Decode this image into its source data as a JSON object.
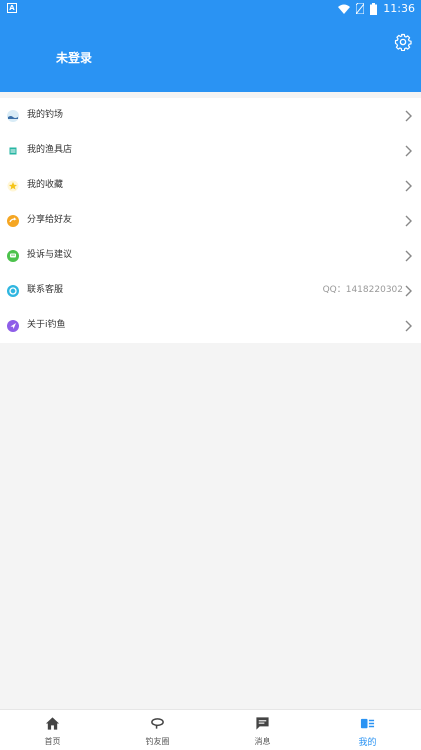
{
  "status_bar": {
    "left_badge": "A",
    "time": "11:36"
  },
  "header": {
    "login_label": "未登录"
  },
  "menu": [
    {
      "label": "我的钓场",
      "icon": "fishing-spot-icon",
      "extra": ""
    },
    {
      "label": "我的渔具店",
      "icon": "tackle-shop-icon",
      "extra": ""
    },
    {
      "label": "我的收藏",
      "icon": "favorites-icon",
      "extra": ""
    },
    {
      "label": "分享给好友",
      "icon": "share-icon",
      "extra": ""
    },
    {
      "label": "投诉与建议",
      "icon": "feedback-icon",
      "extra": ""
    },
    {
      "label": "联系客服",
      "icon": "customer-service-icon",
      "extra": "QQ：1418220302"
    },
    {
      "label": "关于i钓鱼",
      "icon": "about-icon",
      "extra": ""
    }
  ],
  "tabs": [
    {
      "label": "首页",
      "icon": "home-icon",
      "active": false
    },
    {
      "label": "钓友圈",
      "icon": "circle-icon",
      "active": false
    },
    {
      "label": "消息",
      "icon": "message-icon",
      "active": false
    },
    {
      "label": "我的",
      "icon": "profile-icon",
      "active": true
    }
  ],
  "colors": {
    "primary": "#2a93f3",
    "background": "#f4f4f4",
    "text": "#333333",
    "muted": "#999999"
  }
}
